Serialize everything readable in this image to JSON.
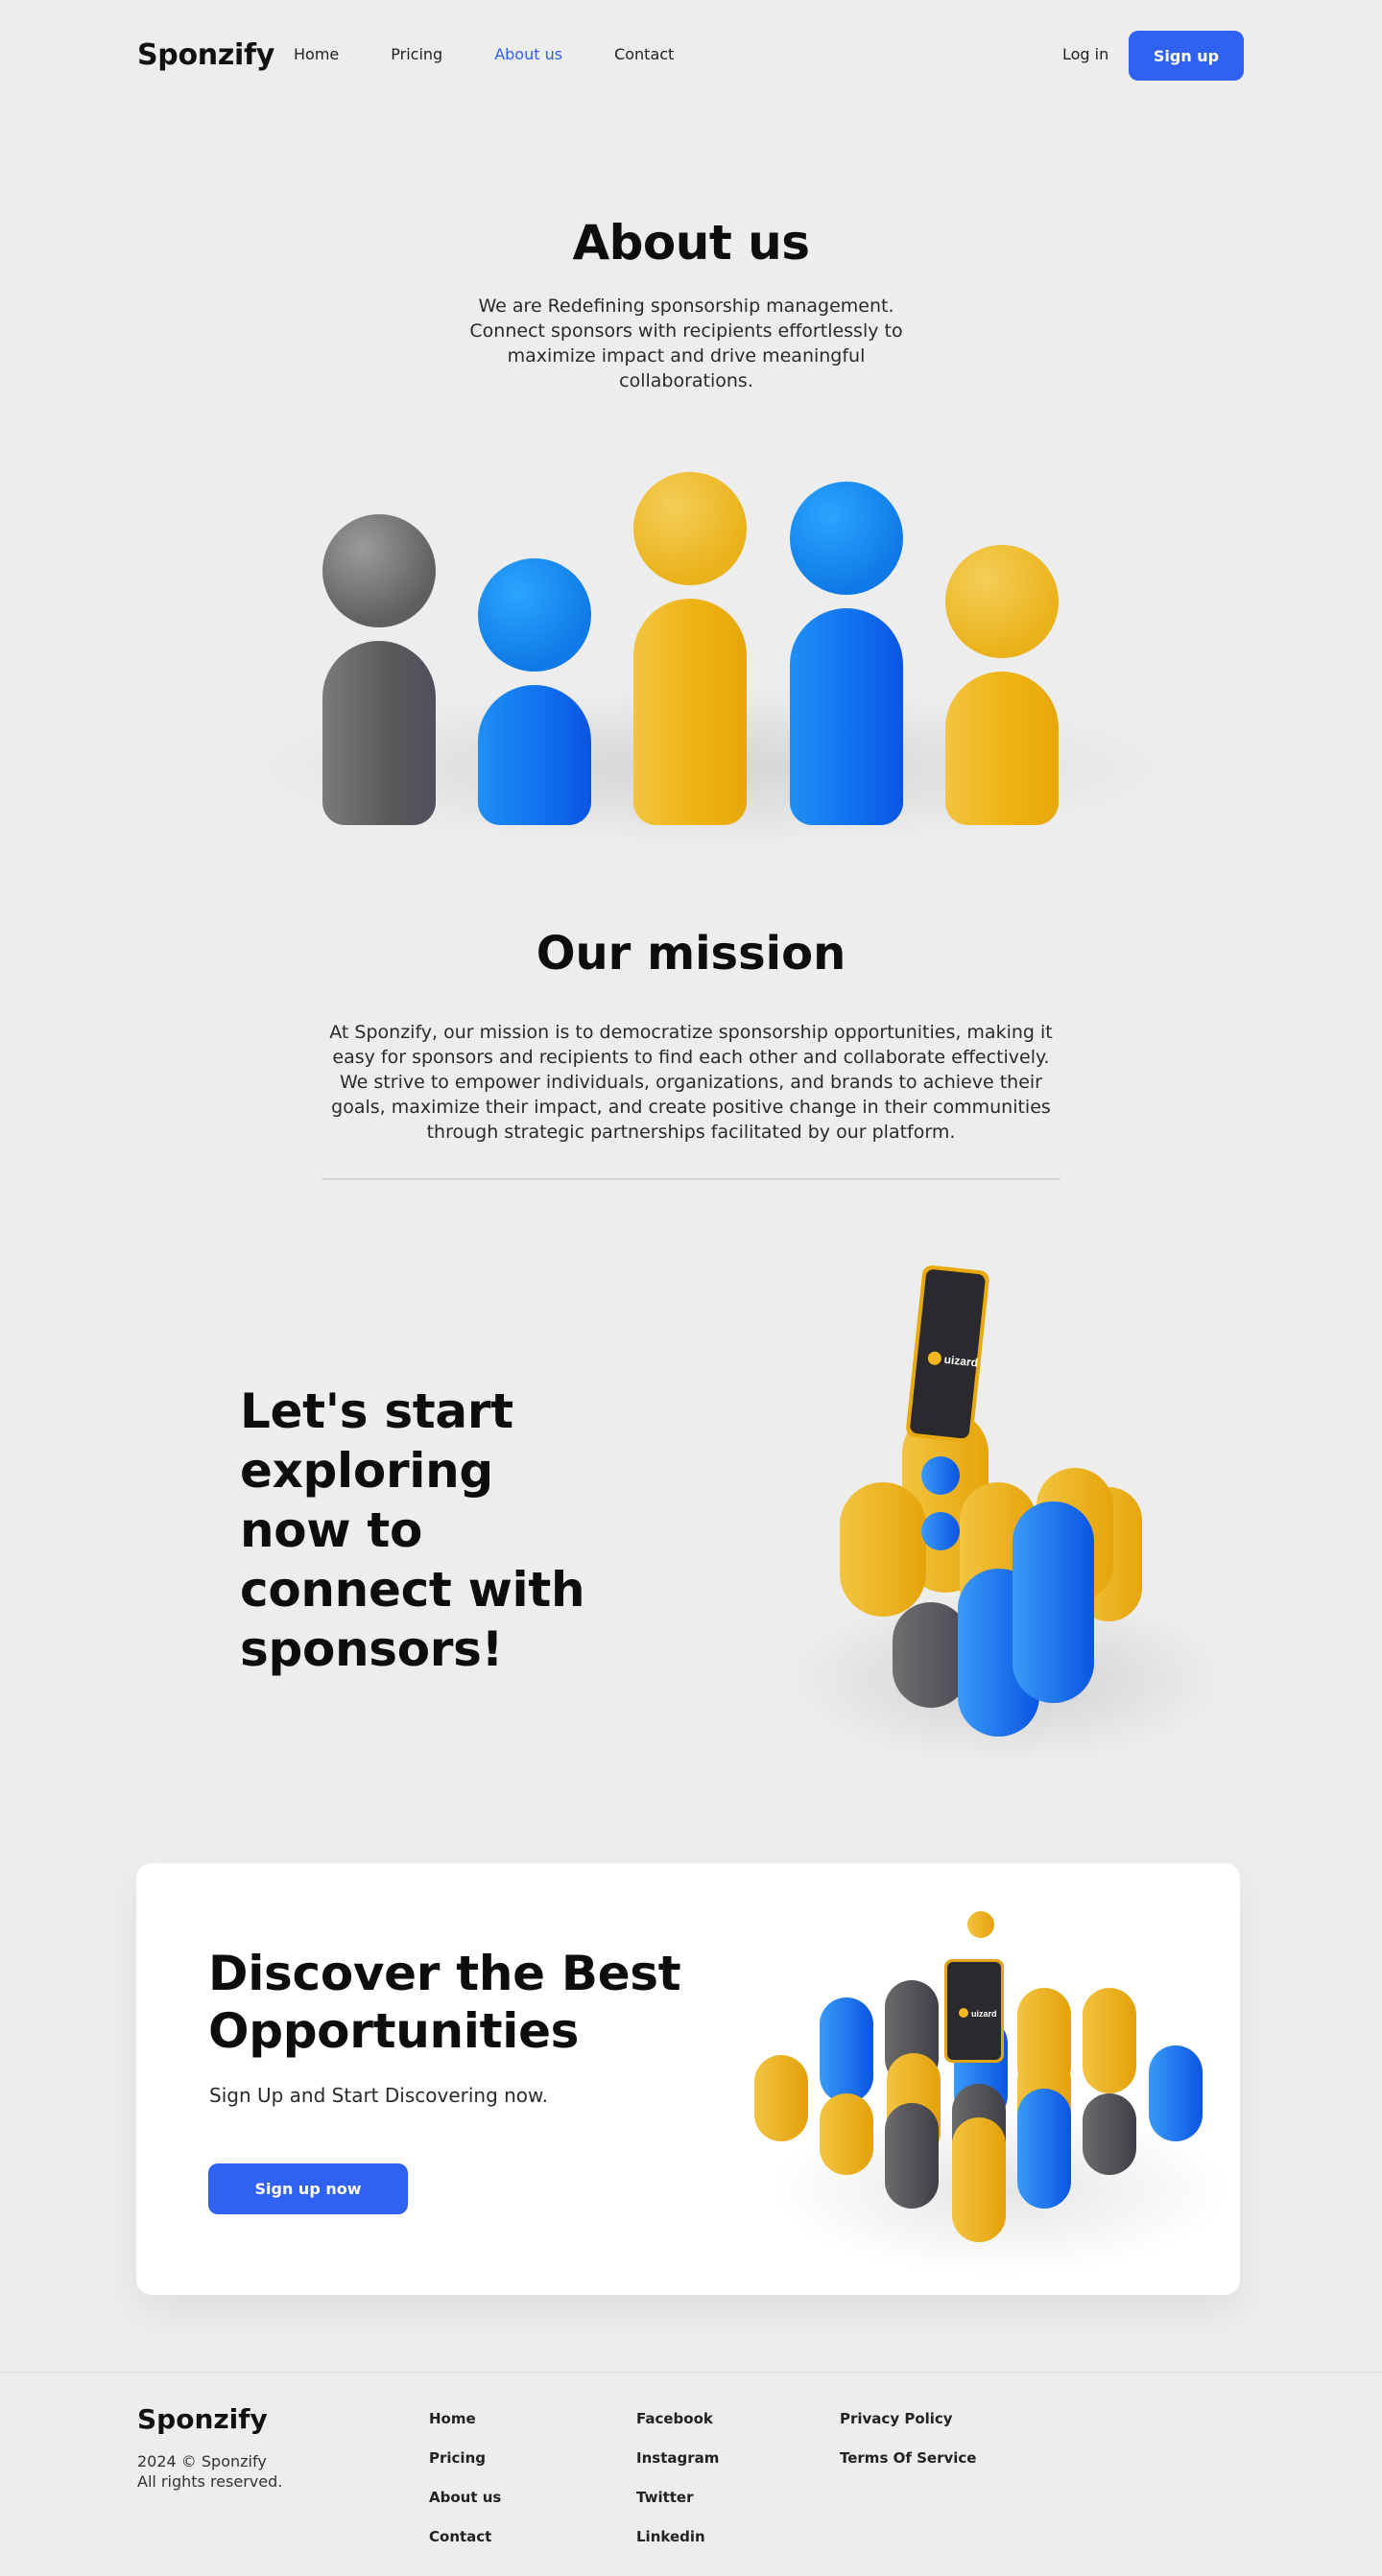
{
  "nav": {
    "logo": "Sponzify",
    "links": [
      "Home",
      "Pricing",
      "About us",
      "Contact"
    ],
    "active": "About us",
    "login": "Log in",
    "signup": "Sign up"
  },
  "about": {
    "title": "About us",
    "description": "We are Redefining sponsorship management. Connect sponsors with recipients effortlessly to maximize impact and drive meaningful collaborations."
  },
  "mission": {
    "title": "Our mission",
    "description": "At Sponzify, our mission is to democratize sponsorship opportunities, making it easy for sponsors and recipients to find each other and collaborate effectively. We strive to empower individuals, organizations, and brands to achieve their goals, maximize their impact, and create positive change in their communities through strategic partnerships facilitated by our platform."
  },
  "explore": {
    "title": "Let's start exploring now to connect with sponsors!",
    "phone_brand": "uizard"
  },
  "cta": {
    "title": "Discover the Best Opportunities",
    "subtitle": "Sign Up and Start Discovering now.",
    "button": "Sign up now",
    "phone_brand": "uizard"
  },
  "footer": {
    "logo": "Sponzify",
    "copyright_line1": "2024 © Sponzify",
    "copyright_line2": "All rights reserved.",
    "col1": [
      "Home",
      "Pricing",
      "About us",
      "Contact"
    ],
    "col2": [
      "Facebook",
      "Instagram",
      "Twitter",
      "Linkedin"
    ],
    "col3": [
      "Privacy Policy",
      "Terms Of Service"
    ]
  },
  "colors": {
    "accent": "#2f62f2",
    "background": "#ededed",
    "figure_blue": "#0f6ff0",
    "figure_yellow": "#eeb210",
    "figure_gray": "#5f5f5f"
  }
}
